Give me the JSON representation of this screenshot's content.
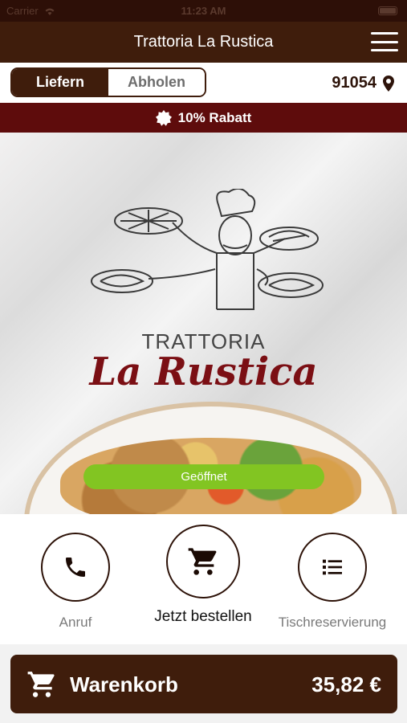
{
  "status_bar": {
    "carrier": "Carrier",
    "time": "11:23 AM"
  },
  "header": {
    "title": "Trattoria La Rustica"
  },
  "delivery_mode": {
    "options": [
      "Liefern",
      "Abholen"
    ],
    "selected": "Liefern"
  },
  "location": {
    "zip": "91054"
  },
  "promo": {
    "text": "10% Rabatt"
  },
  "hero": {
    "logo_line1": "TRATTORIA",
    "logo_line2": "La Rustica"
  },
  "status": {
    "open_label": "Geöffnet"
  },
  "actions": [
    {
      "label": "Anruf",
      "icon": "phone-icon"
    },
    {
      "label": "Jetzt bestellen",
      "icon": "cart-icon"
    },
    {
      "label": "Tischreservierung",
      "icon": "list-icon"
    }
  ],
  "cart": {
    "label": "Warenkorb",
    "total": "35,82 €"
  },
  "colors": {
    "brand_dark": "#3f1d0c",
    "promo_red": "#5e0c0c",
    "open_green": "#82c522",
    "logo_red": "#7b0f14"
  }
}
